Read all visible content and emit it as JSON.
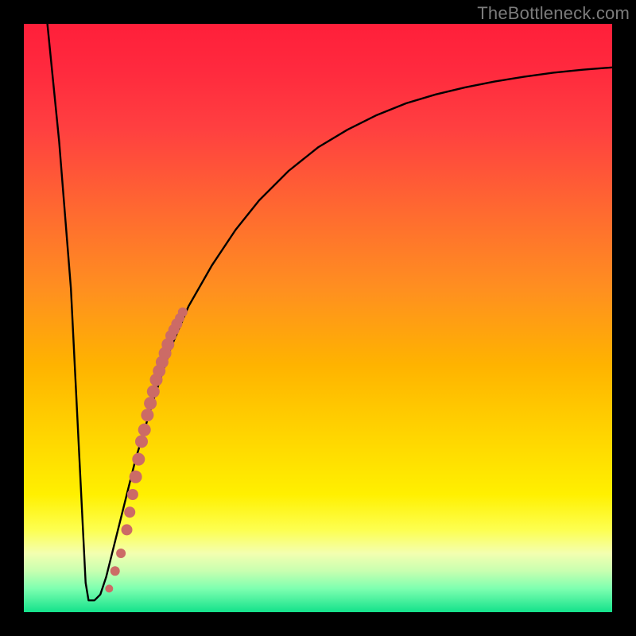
{
  "watermark": "TheBottleneck.com",
  "chart_data": {
    "type": "line",
    "title": "",
    "xlabel": "",
    "ylabel": "",
    "xlim": [
      0,
      100
    ],
    "ylim": [
      0,
      100
    ],
    "curve": {
      "x": [
        4,
        6,
        8,
        9,
        10,
        10.5,
        11,
        12,
        13,
        14,
        15,
        17,
        19,
        22,
        25,
        28,
        32,
        36,
        40,
        45,
        50,
        55,
        60,
        65,
        70,
        75,
        80,
        85,
        90,
        95,
        100
      ],
      "y": [
        100,
        80,
        55,
        35,
        15,
        5,
        2,
        2,
        3,
        6,
        10,
        18,
        26,
        36,
        45,
        52,
        59,
        65,
        70,
        75,
        79,
        82,
        84.5,
        86.5,
        88,
        89.2,
        90.2,
        91,
        91.7,
        92.2,
        92.6
      ]
    },
    "markers": {
      "x": [
        14.5,
        15.5,
        16.5,
        17.5,
        18.0,
        18.5,
        19.0,
        19.5,
        20.0,
        20.5,
        21.0,
        21.5,
        22.0,
        22.5,
        23.0,
        23.5,
        24.0,
        24.5,
        25.0,
        25.5,
        26.0,
        26.5,
        27.0
      ],
      "y": [
        4,
        7,
        10,
        14,
        17,
        20,
        23,
        26,
        29,
        31,
        33.5,
        35.5,
        37.5,
        39.5,
        41,
        42.5,
        44,
        45.5,
        47,
        48,
        49,
        50,
        51
      ],
      "color": "#cc6b66",
      "radii": [
        5,
        6,
        6,
        7,
        7,
        7,
        8,
        8,
        8,
        8,
        8,
        8,
        8,
        8,
        8,
        8,
        8,
        8,
        7,
        7,
        7,
        6,
        6
      ]
    },
    "line_color": "#000000",
    "line_width": 2.4
  }
}
